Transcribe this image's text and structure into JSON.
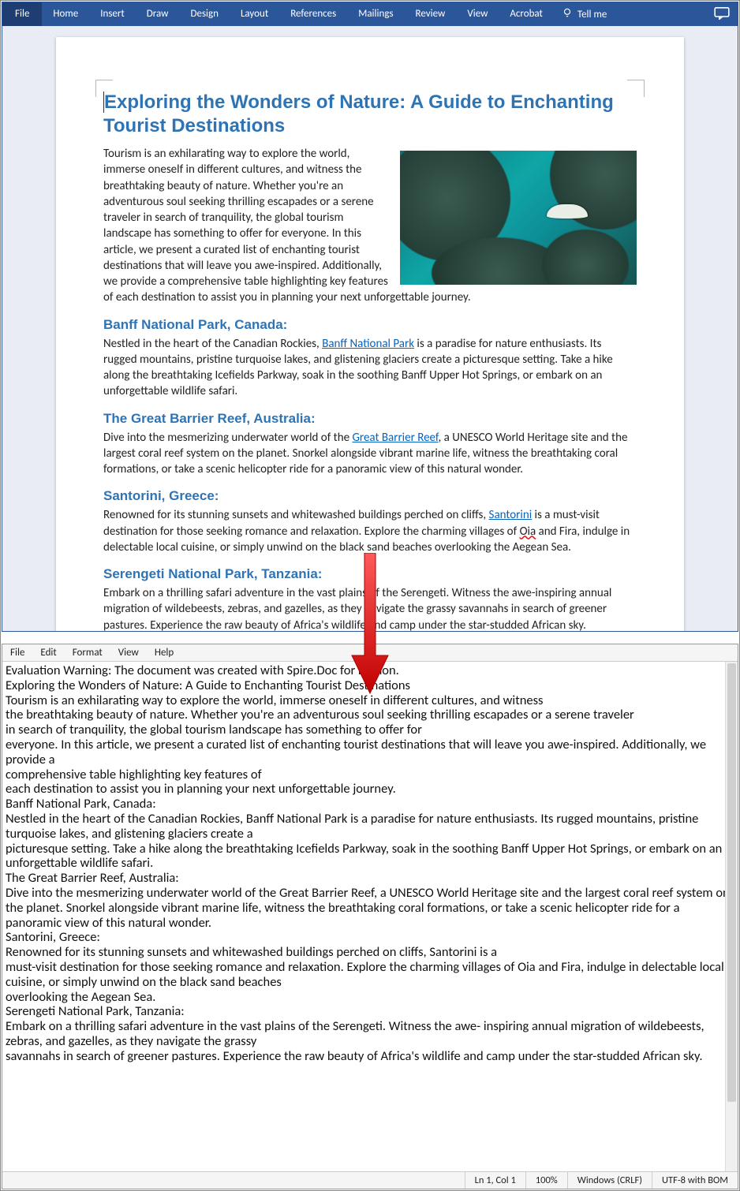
{
  "word": {
    "tabs": [
      "File",
      "Home",
      "Insert",
      "Draw",
      "Design",
      "Layout",
      "References",
      "Mailings",
      "Review",
      "View",
      "Acrobat"
    ],
    "tellme": "Tell me"
  },
  "doc": {
    "title": "Exploring the Wonders of Nature: A Guide to Enchanting Tourist Destinations",
    "intro": "Tourism is an exhilarating way to explore the world, immerse oneself in different cultures, and witness the breathtaking beauty of nature. Whether you're an adventurous soul seeking thrilling escapades or a serene traveler in search of tranquility, the global tourism landscape has something to offer for everyone. In this article, we present a curated list of enchanting tourist destinations that will leave you awe-inspired. Additionally, we provide a comprehensive table highlighting key features of each destination to assist you in planning your next unforgettable journey.",
    "s1": {
      "head": "Banff National Park, Canada:",
      "pre": "Nestled in the heart of the Canadian Rockies, ",
      "link": "Banff National Park",
      "post": " is a paradise for nature enthusiasts. Its rugged mountains, pristine turquoise lakes, and glistening glaciers create a picturesque setting. Take a hike along the breathtaking Icefields Parkway, soak in the soothing Banff Upper Hot Springs, or embark on an unforgettable wildlife safari."
    },
    "s2": {
      "head": "The Great Barrier Reef, Australia:",
      "pre": "Dive into the mesmerizing underwater world of the ",
      "link": "Great Barrier Reef",
      "post": ", a UNESCO World Heritage site and the largest coral reef system on the planet. Snorkel alongside vibrant marine life, witness the breathtaking coral formations, or take a scenic helicopter ride for a panoramic view of this natural wonder."
    },
    "s3": {
      "head": "Santorini, Greece:",
      "pre": "Renowned for its stunning sunsets and whitewashed buildings perched on cliffs, ",
      "link": "Santorini",
      "post": " is a must-visit destination for those seeking romance and relaxation. Explore the charming villages of ",
      "oia": "Oia",
      "tail": " and Fira, indulge in delectable local cuisine, or simply unwind on the black sand beaches overlooking the Aegean Sea."
    },
    "s4": {
      "head": "Serengeti National Park, Tanzania:",
      "text": "Embark on a thrilling safari adventure in the vast plains of the Serengeti. Witness the awe-inspiring annual migration of wildebeests, zebras, and gazelles, as they navigate the grassy savannahs in search of greener pastures. Experience the raw beauty of Africa's wildlife and camp under the star-studded African sky."
    }
  },
  "editor": {
    "menus": [
      "File",
      "Edit",
      "Format",
      "View",
      "Help"
    ],
    "text": "Evaluation Warning: The document was created with Spire.Doc for Python.\nExploring the Wonders of Nature: A Guide to Enchanting Tourist Destinations\nTourism is an exhilarating way to explore the world, immerse oneself in different cultures, and witness\nthe breathtaking beauty of nature. Whether you're an adventurous soul seeking thrilling escapades or a serene traveler\nin search of tranquility, the global tourism landscape has something to offer for\neveryone. In this article, we present a curated list of enchanting tourist destinations that will leave you awe-inspired. Additionally, we provide a\ncomprehensive table highlighting key features of\neach destination to assist you in planning your next unforgettable journey.\nBanff National Park, Canada:\nNestled in the heart of the Canadian Rockies, Banff National Park is a paradise for nature enthusiasts. Its rugged mountains, pristine turquoise lakes, and glistening glaciers create a\npicturesque setting. Take a hike along the breathtaking Icefields Parkway, soak in the soothing Banff Upper Hot Springs, or embark on an unforgettable wildlife safari.\nThe Great Barrier Reef, Australia:\nDive into the mesmerizing underwater world of the Great Barrier Reef, a UNESCO World Heritage site and the largest coral reef system on the planet. Snorkel alongside vibrant marine life, witness the breathtaking coral formations, or take a scenic helicopter ride for a panoramic view of this natural wonder.\nSantorini, Greece:\nRenowned for its stunning sunsets and whitewashed buildings perched on cliffs, Santorini is a\nmust-visit destination for those seeking romance and relaxation. Explore the charming villages of Oia and Fira, indulge in delectable local cuisine, or simply unwind on the black sand beaches\noverlooking the Aegean Sea.\nSerengeti National Park, Tanzania:\nEmbark on a thrilling safari adventure in the vast plains of the Serengeti. Witness the awe- inspiring annual migration of wildebeests, zebras, and gazelles, as they navigate the grassy\nsavannahs in search of greener pastures. Experience the raw beauty of Africa's wildlife and camp under the star-studded African sky.",
    "status": {
      "pos": "Ln 1, Col 1",
      "zoom": "100%",
      "eol": "Windows (CRLF)",
      "enc": "UTF-8 with BOM"
    }
  }
}
